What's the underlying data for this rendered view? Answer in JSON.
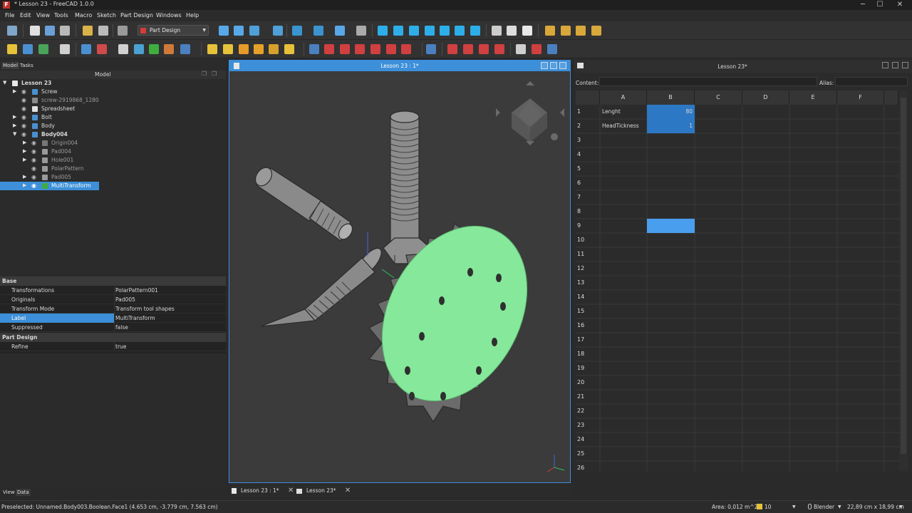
{
  "app": {
    "title": "* Lesson 23 - FreeCAD 1.0.0"
  },
  "menubar": [
    "File",
    "Edit",
    "View",
    "Tools",
    "Macro",
    "Sketch",
    "Part Design",
    "Windows",
    "Help"
  ],
  "toolbar": {
    "workbench": "Part Design"
  },
  "combo_view": {
    "tabs": [
      "Model",
      "Tasks"
    ],
    "header": "Model",
    "tree": [
      {
        "label": "Lesson 23",
        "bold": true
      },
      {
        "label": "Screw"
      },
      {
        "label": "screw-2919868_1280"
      },
      {
        "label": "Spreadsheet"
      },
      {
        "label": "Bolt"
      },
      {
        "label": "Body"
      },
      {
        "label": "Body004",
        "bold": true
      },
      {
        "label": "Origin004"
      },
      {
        "label": "Pad004"
      },
      {
        "label": "Hole001"
      },
      {
        "label": "PolarPattern"
      },
      {
        "label": "Pad005"
      },
      {
        "label": "MultiTransform"
      }
    ],
    "bottom_tabs": [
      "View",
      "Data"
    ]
  },
  "properties": {
    "group_base": "Base",
    "rows": [
      {
        "key": "Transformations",
        "value": "PolarPattern001"
      },
      {
        "key": "Originals",
        "value": "Pad005"
      },
      {
        "key": "Transform Mode",
        "value": "Transform tool shapes"
      },
      {
        "key": "Label",
        "value": "MultiTransform"
      },
      {
        "key": "Suppressed",
        "value": "false"
      }
    ],
    "group_part": "Part Design",
    "refine": {
      "key": "Refine",
      "value": "true"
    }
  },
  "view3d": {
    "title": "Lesson 23 : 1*"
  },
  "spreadsheet": {
    "title": "Lesson 23*",
    "content_label": "Content:",
    "alias_label": "Alias:",
    "columns": [
      "A",
      "B",
      "C",
      "D",
      "E",
      "F"
    ],
    "rows": [
      "1",
      "2",
      "3",
      "4",
      "5",
      "6",
      "7",
      "8",
      "9",
      "10",
      "11",
      "12",
      "13",
      "14",
      "15",
      "16",
      "17",
      "18",
      "19",
      "20",
      "21",
      "22",
      "23",
      "24",
      "25",
      "26"
    ],
    "cells": {
      "a1": "Lenght",
      "b1": "80",
      "a2": "HeadTickness",
      "b2": "1"
    }
  },
  "doc_tabs": [
    "Lesson 23 : 1*",
    "Lesson 23*"
  ],
  "status": {
    "preselected": "Preselected: Unnamed.Body003.Boolean.Face1 (4.653 cm, -3.779 cm, 7.563 cm)",
    "area": "Area: 0,012 m^2",
    "grid": "10",
    "nav": "Blender",
    "dims": "22,89 cm x 18,99 cm"
  },
  "colors": {
    "accent": "#3c8fd8",
    "gear_face": "#85e89a"
  }
}
